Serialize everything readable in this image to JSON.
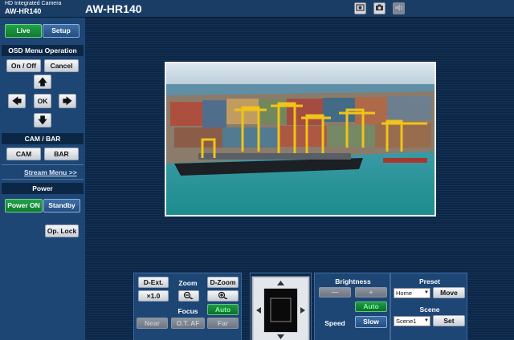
{
  "header": {
    "brand_line1": "HD Integrated Camera",
    "brand_line2": "AW-HR140",
    "model": "AW-HR140",
    "icons": [
      "snapshot-icon",
      "camera-icon",
      "mute-icon"
    ]
  },
  "sidebar": {
    "tab_live": "Live",
    "tab_setup": "Setup",
    "osd_title": "OSD Menu Operation",
    "osd_onoff": "On / Off",
    "osd_cancel": "Cancel",
    "osd_ok": "OK",
    "cambar_title": "CAM / BAR",
    "cam": "CAM",
    "bar": "BAR",
    "stream_menu": "Stream Menu >>",
    "power_title": "Power",
    "power_on": "Power ON",
    "standby": "Standby",
    "op_lock": "Op. Lock"
  },
  "controls": {
    "dext": "D-Ext.",
    "zoom_title": "Zoom",
    "dzoom": "D-Zoom",
    "zoom_value": "×1.0",
    "zoom_minus": "−",
    "zoom_plus": "+",
    "focus_title": "Focus",
    "focus_auto": "Auto",
    "near": "Near",
    "otaf": "O.T. AF",
    "far": "Far",
    "brightness_title": "Brightness",
    "brightness_minus": "—",
    "brightness_plus": "+",
    "brightness_auto": "Auto",
    "speed_title": "Speed",
    "speed_value": "Slow",
    "preset_title": "Preset",
    "preset_select": "Home",
    "preset_move": "Move",
    "scene_title": "Scene",
    "scene_select": "Scene1",
    "scene_set": "Set"
  },
  "colors": {
    "accent_green": "#0d7a2e",
    "panel_blue": "#1d4675",
    "background": "#0f2a4a"
  }
}
